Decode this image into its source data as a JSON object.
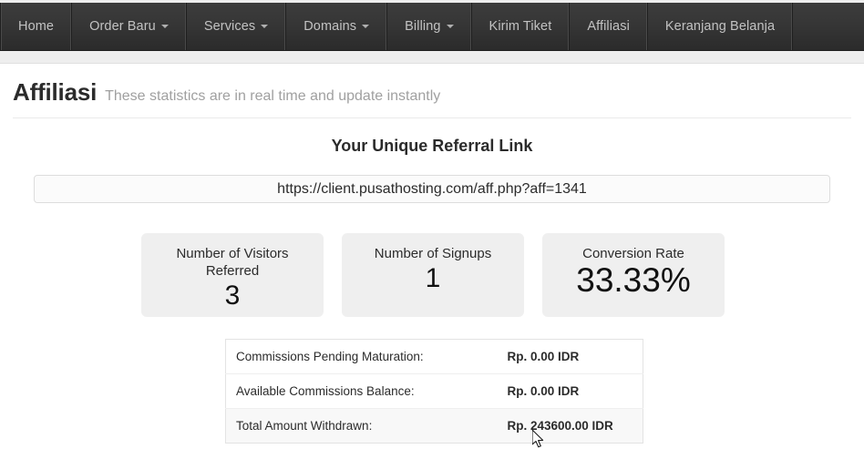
{
  "navbar": {
    "items": [
      {
        "label": "Home",
        "caret": false
      },
      {
        "label": "Order Baru",
        "caret": true
      },
      {
        "label": "Services",
        "caret": true
      },
      {
        "label": "Domains",
        "caret": true
      },
      {
        "label": "Billing",
        "caret": true
      },
      {
        "label": "Kirim Tiket",
        "caret": false
      },
      {
        "label": "Affiliasi",
        "caret": false
      },
      {
        "label": "Keranjang Belanja",
        "caret": false
      }
    ]
  },
  "header": {
    "title": "Affiliasi",
    "subtitle": "These statistics are in real time and update instantly"
  },
  "referral": {
    "heading": "Your Unique Referral Link",
    "url": "https://client.pusathosting.com/aff.php?aff=1341"
  },
  "stats": [
    {
      "label": "Number of Visitors Referred",
      "value": "3"
    },
    {
      "label": "Number of Signups",
      "value": "1"
    },
    {
      "label": "Conversion Rate",
      "value": "33.33%"
    }
  ],
  "commissions": {
    "rows": [
      {
        "label": "Commissions Pending Maturation:",
        "value": "Rp. 0.00 IDR"
      },
      {
        "label": "Available Commissions Balance:",
        "value": "Rp. 0.00 IDR"
      },
      {
        "label": "Total Amount Withdrawn:",
        "value": "Rp. 243600.00 IDR"
      }
    ]
  },
  "colors": {
    "navbar_dark": "#363636",
    "stat_box_bg": "#efefef",
    "subtitle_grey": "#a0a0a0",
    "text_dark": "#2b2b2b"
  }
}
